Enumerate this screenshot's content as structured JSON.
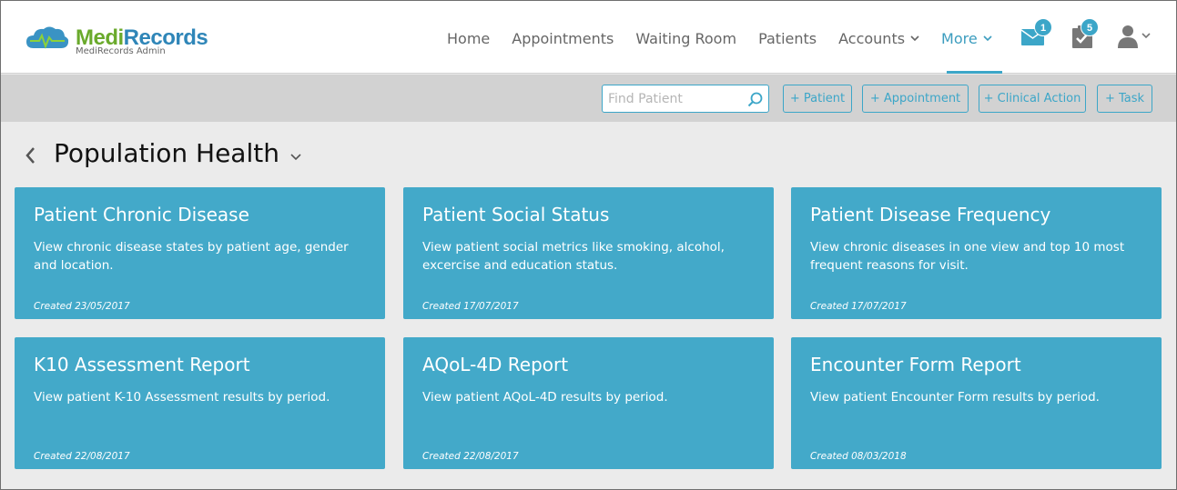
{
  "brand": {
    "name_part1": "Medi",
    "name_part2": "Records",
    "subtitle": "MediRecords Admin"
  },
  "nav": {
    "items": [
      {
        "label": "Home"
      },
      {
        "label": "Appointments"
      },
      {
        "label": "Waiting Room"
      },
      {
        "label": "Patients"
      },
      {
        "label": "Accounts"
      },
      {
        "label": "More"
      }
    ],
    "active": "More"
  },
  "header_icons": {
    "messages_count": "1",
    "tasks_count": "5",
    "messages_icon": "envelope-icon",
    "tasks_icon": "clipboard-check-icon",
    "user_icon": "user-icon"
  },
  "toolbar": {
    "search_placeholder": "Find Patient",
    "buttons": [
      "+ Patient",
      "+ Appointment",
      "+ Clinical Action",
      "+ Task"
    ]
  },
  "page": {
    "title": "Population Health"
  },
  "cards": [
    {
      "title": "Patient Chronic Disease",
      "description": "View chronic disease states by patient age, gender and location.",
      "date": "Created 23/05/2017"
    },
    {
      "title": "Patient Social Status",
      "description": "View patient social metrics like smoking, alcohol, excercise and education status.",
      "date": "Created 17/07/2017"
    },
    {
      "title": "Patient Disease Frequency",
      "description": "View chronic diseases in one view and top 10 most frequent reasons for visit.",
      "date": "Created 17/07/2017"
    },
    {
      "title": "K10 Assessment Report",
      "description": "View patient K-10 Assessment results by period.",
      "date": "Created 22/08/2017"
    },
    {
      "title": "AQoL-4D Report",
      "description": "View patient AQoL-4D results by period.",
      "date": "Created 22/08/2017"
    },
    {
      "title": "Encounter Form Report",
      "description": "View patient Encounter Form results by period.",
      "date": "Created 08/03/2018"
    }
  ],
  "colors": {
    "accent": "#3ca6c8",
    "card_bg": "#43a9c9",
    "brand_green": "#6aaa2c",
    "brand_blue": "#2f86b8",
    "toolbar_bg": "#d2d2d2",
    "page_bg": "#ebebeb"
  }
}
